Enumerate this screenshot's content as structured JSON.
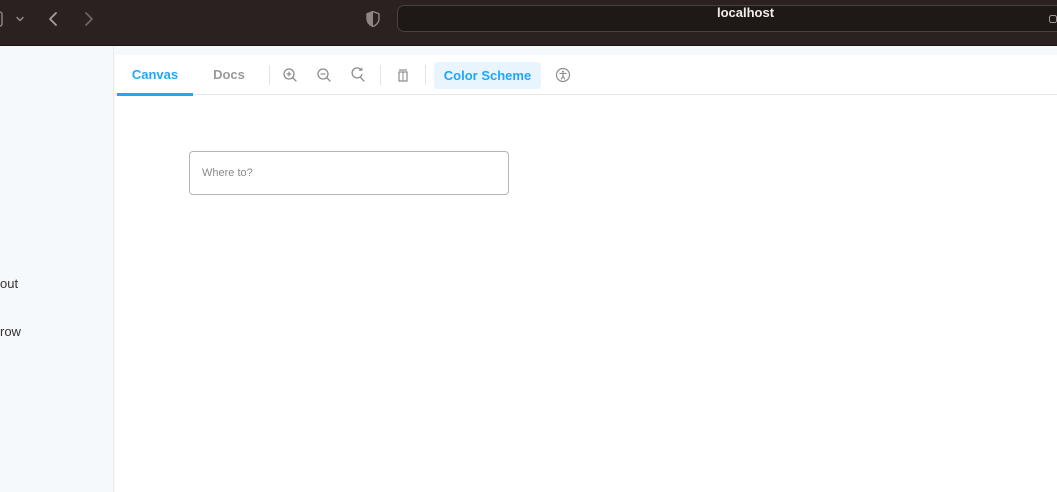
{
  "browser": {
    "url": "localhost"
  },
  "sidebar": {
    "items": [
      {
        "label": "out"
      },
      {
        "label": "row"
      }
    ]
  },
  "toolbar": {
    "tabs": [
      {
        "label": "Canvas",
        "active": true
      },
      {
        "label": "Docs",
        "active": false
      }
    ],
    "tools": [
      "zoom-in-icon",
      "zoom-out-icon",
      "reset-zoom-icon",
      "viewport-icon"
    ],
    "color_scheme_label": "Color Scheme",
    "accessibility": "accessibility-icon"
  },
  "canvas": {
    "search": {
      "value": "",
      "placeholder": "Where to?"
    }
  },
  "colors": {
    "accent": "#1ea7fd",
    "browser_chrome": "#2a2120"
  }
}
